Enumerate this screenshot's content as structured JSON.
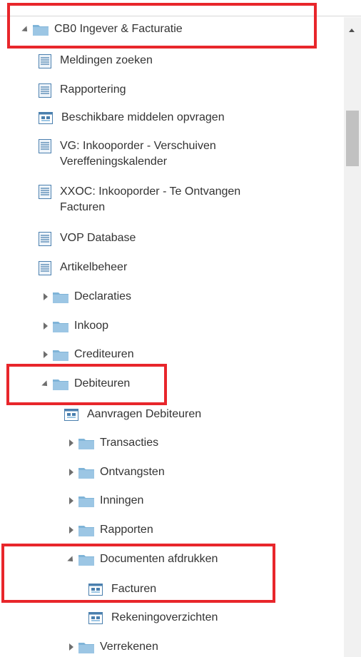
{
  "tree": {
    "root": {
      "label": "CB0 Ingever & Facturatie",
      "expanded": true
    },
    "items": [
      {
        "label": "Meldingen zoeken",
        "icon": "document-icon"
      },
      {
        "label": "Rapportering",
        "icon": "document-icon"
      },
      {
        "label": "Beschikbare middelen opvragen",
        "icon": "app-window-icon"
      },
      {
        "label": "VG: Inkooporder - Verschuiven Vereffeningskalender",
        "icon": "document-icon"
      },
      {
        "label": "XXOC: Inkooporder - Te Ontvangen Facturen",
        "icon": "document-icon"
      },
      {
        "label": "VOP Database",
        "icon": "document-icon"
      },
      {
        "label": "Artikelbeheer",
        "icon": "document-icon"
      }
    ],
    "folders": [
      {
        "label": "Declaraties",
        "expanded": false
      },
      {
        "label": "Inkoop",
        "expanded": false
      },
      {
        "label": "Crediteuren",
        "expanded": false
      },
      {
        "label": "Debiteuren",
        "expanded": true
      }
    ],
    "debiteuren": {
      "app": {
        "label": "Aanvragen Debiteuren",
        "icon": "app-window-icon"
      },
      "folders": [
        {
          "label": "Transacties",
          "expanded": false
        },
        {
          "label": "Ontvangsten",
          "expanded": false
        },
        {
          "label": "Inningen",
          "expanded": false
        },
        {
          "label": "Rapporten",
          "expanded": false
        },
        {
          "label": "Documenten afdrukken",
          "expanded": true
        }
      ],
      "documenten": [
        {
          "label": "Facturen",
          "icon": "app-window-icon"
        },
        {
          "label": "Rekeningoverzichten",
          "icon": "app-window-icon"
        }
      ],
      "last_folder": {
        "label": "Verrekenen",
        "expanded": false
      }
    }
  },
  "colors": {
    "highlight": "#e8262b",
    "folder": "#7fb4d8",
    "icon_blue": "#4a7fae",
    "text": "#333333"
  }
}
